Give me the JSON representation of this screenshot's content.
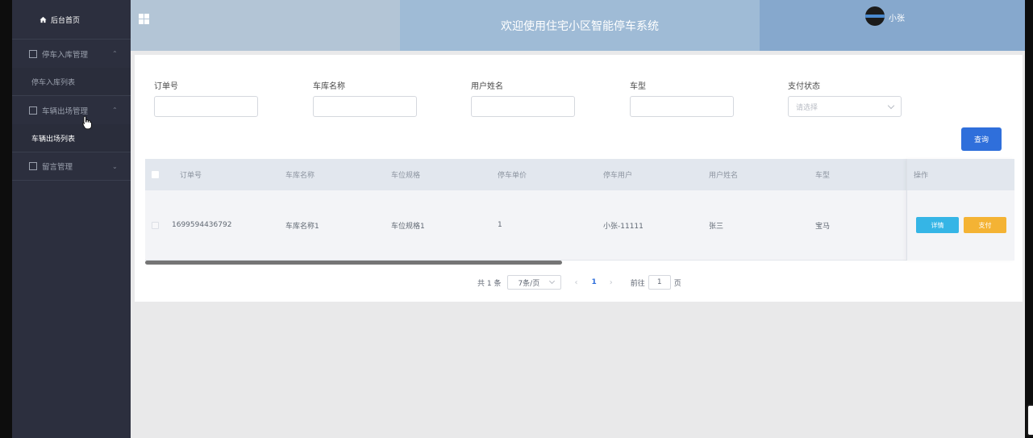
{
  "sidebar": {
    "home": "后台首页",
    "menus": [
      {
        "label": "停车入库管理",
        "sub": "停车入库列表"
      },
      {
        "label": "车辆出场管理",
        "sub": "车辆出场列表"
      },
      {
        "label": "留言管理"
      }
    ]
  },
  "header": {
    "title": "欢迎使用住宅小区智能停车系统",
    "user": "小张"
  },
  "filters": {
    "order_no": {
      "label": "订单号",
      "value": ""
    },
    "garage_name": {
      "label": "车库名称",
      "value": ""
    },
    "user_name": {
      "label": "用户姓名",
      "value": ""
    },
    "car_type": {
      "label": "车型",
      "value": ""
    },
    "pay_status": {
      "label": "支付状态",
      "placeholder": "请选择"
    },
    "search_label": "查询"
  },
  "table": {
    "columns": [
      "订单号",
      "车库名称",
      "车位规格",
      "停车单价",
      "停车用户",
      "用户姓名",
      "车型",
      "操作"
    ],
    "rows": [
      {
        "order_no": "1699594436792",
        "garage_name": "车库名称1",
        "spec": "车位规格1",
        "price": "1",
        "parking_user": "小张-11111",
        "user_name": "张三",
        "car_type": "宝马",
        "detail_label": "详情",
        "pay_label": "支付"
      }
    ]
  },
  "pagination": {
    "total": "共 1 条",
    "page_size": "7条/页",
    "current": "1",
    "goto_prefix": "前往",
    "goto_value": "1",
    "goto_suffix": "页"
  },
  "icons": {
    "home": "home-icon",
    "menu_grid": "grid-icon",
    "menu_item": "document-icon",
    "message": "image-icon",
    "expand": "chevron-up-icon",
    "collapse": "chevron-down-icon"
  },
  "colors": {
    "sidebar_bg": "#2c2f3e",
    "primary": "#2f6fdb",
    "detail_btn": "#35b5e6",
    "pay_btn": "#f4b334"
  }
}
